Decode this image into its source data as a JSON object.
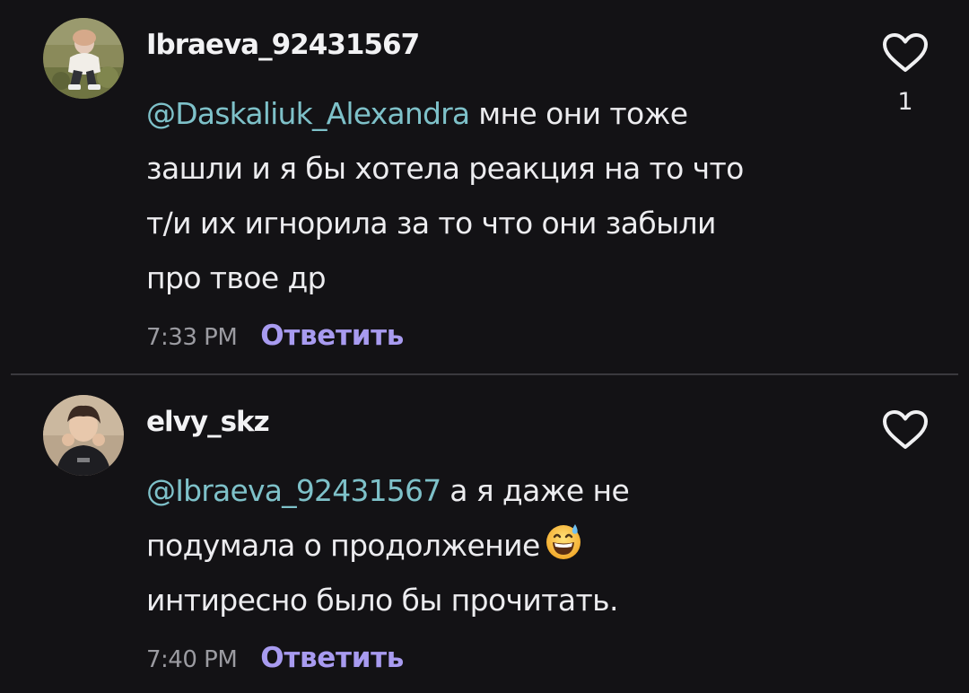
{
  "comments": [
    {
      "username": "Ibraeva_92431567",
      "mention": "@Daskaliuk_Alexandra",
      "text_lines": [
        " мне они тоже",
        "зашли и я бы хотела реакция на то что",
        "т/и их игнорила за то что они забыли",
        "про твое др"
      ],
      "time": "7:33 PM",
      "reply_label": "Ответить",
      "like_count": "1"
    },
    {
      "username": "elvy_skz",
      "mention": "@Ibraeva_92431567",
      "text_lines": [
        " а я даже не",
        "подумала о продолжение",
        "интиресно было бы прочитать."
      ],
      "time": "7:40 PM",
      "reply_label": "Ответить"
    }
  ],
  "icons": {
    "like": "heart-outline-icon",
    "emoji": "grinning-face-with-sweat-emoji"
  },
  "colors": {
    "background": "#131215",
    "mention": "#7ec1c9",
    "reply": "#a89bf0",
    "meta": "#9b9ba1",
    "divider": "#3a393e"
  }
}
